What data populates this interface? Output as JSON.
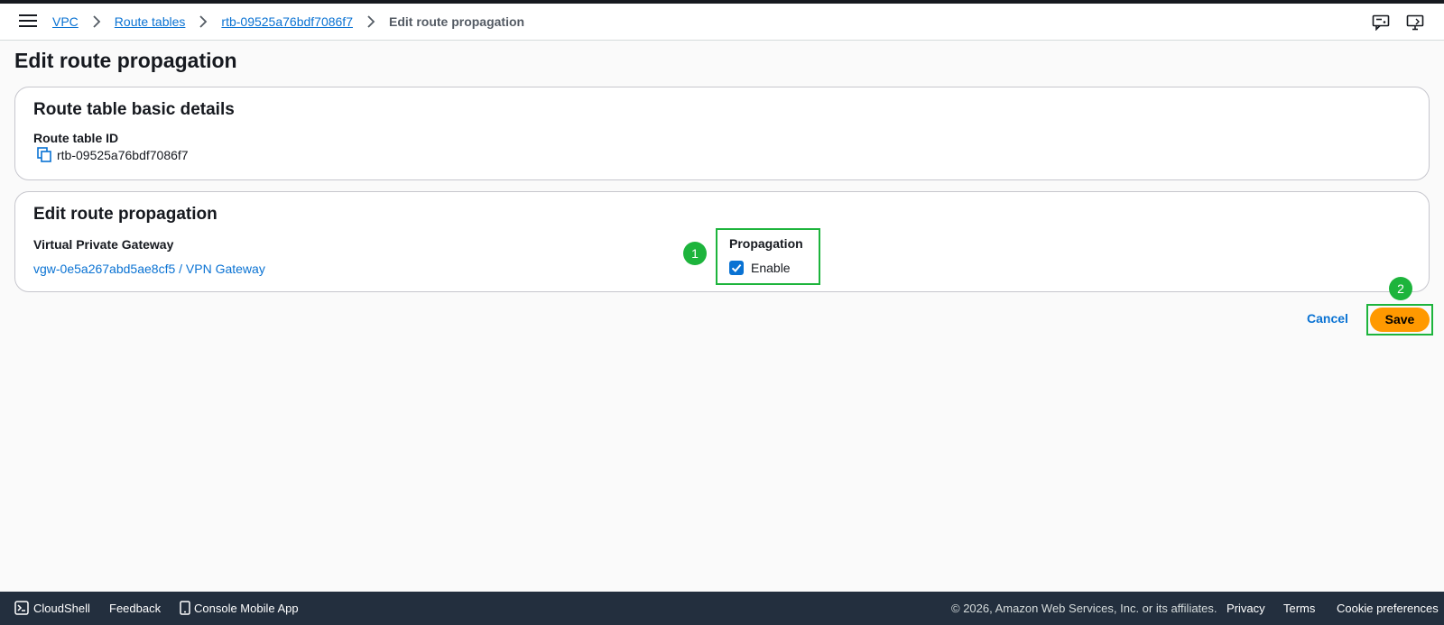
{
  "header": {
    "breadcrumb": {
      "vpc": "VPC",
      "route_tables": "Route tables",
      "route_table_id": "rtb-09525a76bdf7086f7",
      "current": "Edit route propagation"
    },
    "icons": [
      "menu-icon",
      "feedback-icon",
      "display-icon"
    ]
  },
  "page": {
    "title": "Edit route propagation"
  },
  "basic_details": {
    "title": "Route table basic details",
    "route_table_id_label": "Route table ID",
    "route_table_id_value": "rtb-09525a76bdf7086f7"
  },
  "propagation": {
    "title": "Edit route propagation",
    "gateway_label": "Virtual Private Gateway",
    "gateway_value": "vgw-0e5a267abd5ae8cf5 / VPN Gateway",
    "propagation_label": "Propagation",
    "enable_label": "Enable",
    "enabled": true
  },
  "annotations": {
    "step1": "1",
    "step2": "2",
    "highlight_color": "#1db43c"
  },
  "actions": {
    "cancel": "Cancel",
    "save": "Save"
  },
  "footer": {
    "cloudshell": "CloudShell",
    "feedback": "Feedback",
    "mobile_app": "Console Mobile App",
    "copyright": "© 2026, Amazon Web Services, Inc. or its affiliates.",
    "privacy": "Privacy",
    "terms": "Terms",
    "cookie": "Cookie preferences"
  },
  "colors": {
    "link": "#0972d3",
    "primary_button": "#ff9900",
    "footer_bg": "#232f3e"
  }
}
